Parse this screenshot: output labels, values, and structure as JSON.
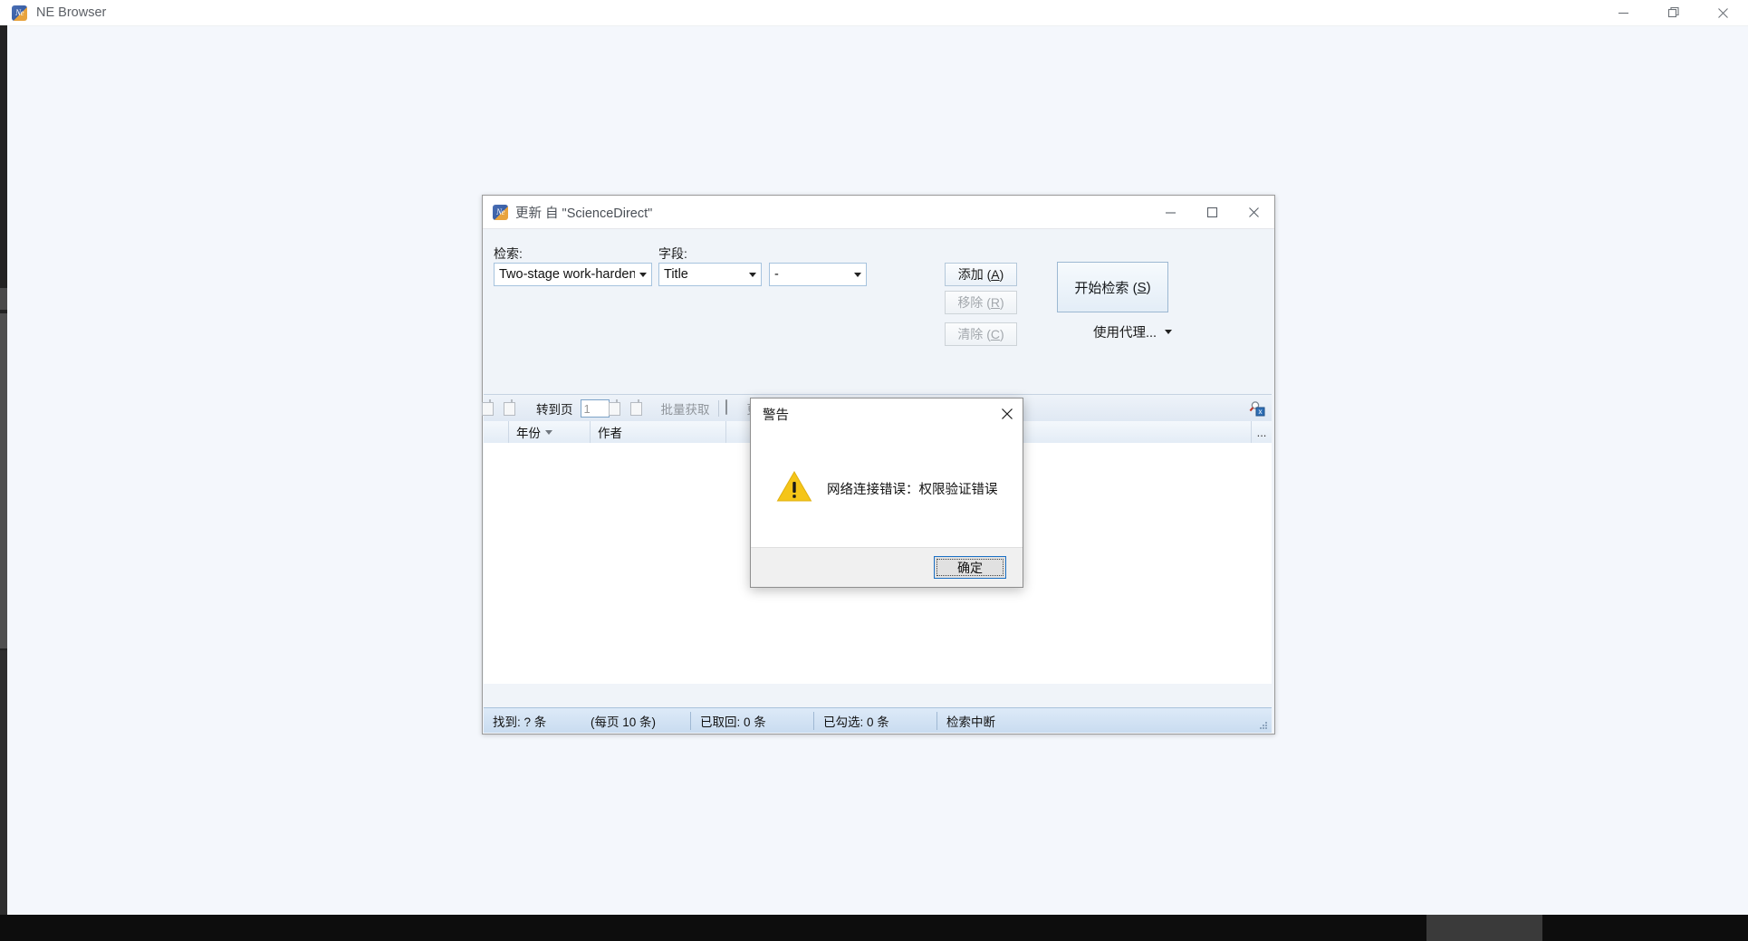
{
  "outer_window": {
    "title": "NE Browser",
    "icon": "app-ne-icon",
    "controls": {
      "minimize": "—",
      "maximize": "❐",
      "close": "✕"
    }
  },
  "inner_window": {
    "title": "更新  自 \"ScienceDirect\"",
    "icon": "app-ne-icon",
    "controls": {
      "minimize": "—",
      "maximize": "□",
      "close": "✕"
    }
  },
  "search_form": {
    "query_label": "检索:",
    "field_label": "字段:",
    "query_value": "Two-stage work-hardening",
    "field_value": "Title",
    "operator_value": "-",
    "buttons": {
      "add": "添加 (A)",
      "add_key": "A",
      "add_prefix": "添加 (",
      "remove_prefix": "移除 (",
      "remove_key": "R",
      "clear_prefix": "清除 (",
      "clear_key": "C",
      "suffix": ")",
      "start_prefix": "开始检索 (",
      "start_key": "S"
    },
    "proxy_label": "使用代理..."
  },
  "list_toolbar": {
    "prev_page_icon": "previous-page-icon",
    "next_page_icon": "next-page-icon",
    "goto_page_label": "转到页",
    "page_number": "1",
    "fetch_page_icon": "fetch-page-icon",
    "refresh_icon": "refresh-icon",
    "batch_fetch_label": "批量获取",
    "database_icon": "database-icon",
    "update_label": "更",
    "search_badge_icon": "search-stop-icon"
  },
  "list_header": {
    "columns": [
      "年份",
      "作者"
    ],
    "sort_indicator": "sort-desc-icon",
    "more_label": "..."
  },
  "status_bar": {
    "found": "找到: ? 条",
    "per_page": "(每页 10 条)",
    "fetched": "已取回: 0 条",
    "checked": "已勾选: 0 条",
    "state": "检索中断"
  },
  "warning_dialog": {
    "title": "警告",
    "close_label": "✕",
    "icon": "warning-triangle-icon",
    "message": "网络连接错误：权限验证错误",
    "ok_label": "确定"
  },
  "colors": {
    "desktop": "#f4f7fc",
    "inner_chrome": "#f0f4f9",
    "status_bar": "#cde0f2",
    "warning_yellow": "#f5c518",
    "accent_blue": "#1a6fc4"
  }
}
